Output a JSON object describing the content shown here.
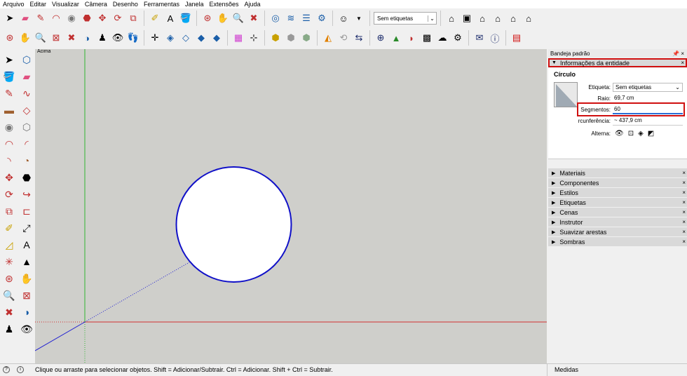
{
  "menu": [
    "Arquivo",
    "Editar",
    "Visualizar",
    "Câmera",
    "Desenho",
    "Ferramentas",
    "Janela",
    "Extensões",
    "Ajuda"
  ],
  "toolbar": {
    "tag_select": "Sem etiquetas"
  },
  "viewport": {
    "label": "Acima"
  },
  "tray": {
    "title": "Bandeja padrão",
    "pins": "📌 ×",
    "entity_panel": {
      "header": "Informações da entidade",
      "type": "Círculo",
      "fields": {
        "etiqueta_label": "Etiqueta:",
        "etiqueta_value": "Sem etiquetas",
        "raio_label": "Raio:",
        "raio_value": "69,7 cm",
        "segmentos_label": "Segmentos:",
        "segmentos_value": "60",
        "circ_label": "rcunferência:",
        "circ_value": "~ 437,9 cm",
        "alterna_label": "Alterna:"
      }
    },
    "panels": [
      "Materiais",
      "Componentes",
      "Estilos",
      "Etiquetas",
      "Cenas",
      "Instrutor",
      "Suavizar arestas",
      "Sombras"
    ]
  },
  "status": {
    "message": "Clique ou arraste para selecionar objetos. Shift = Adicionar/Subtrair. Ctrl = Adicionar. Shift + Ctrl = Subtrair.",
    "measures_label": "Medidas"
  },
  "colors": {
    "accent_red": "#d01010",
    "circle_stroke": "#1010c8",
    "axis_red": "#d23232",
    "axis_green": "#32b432",
    "axis_blue": "#1e1ed2"
  }
}
